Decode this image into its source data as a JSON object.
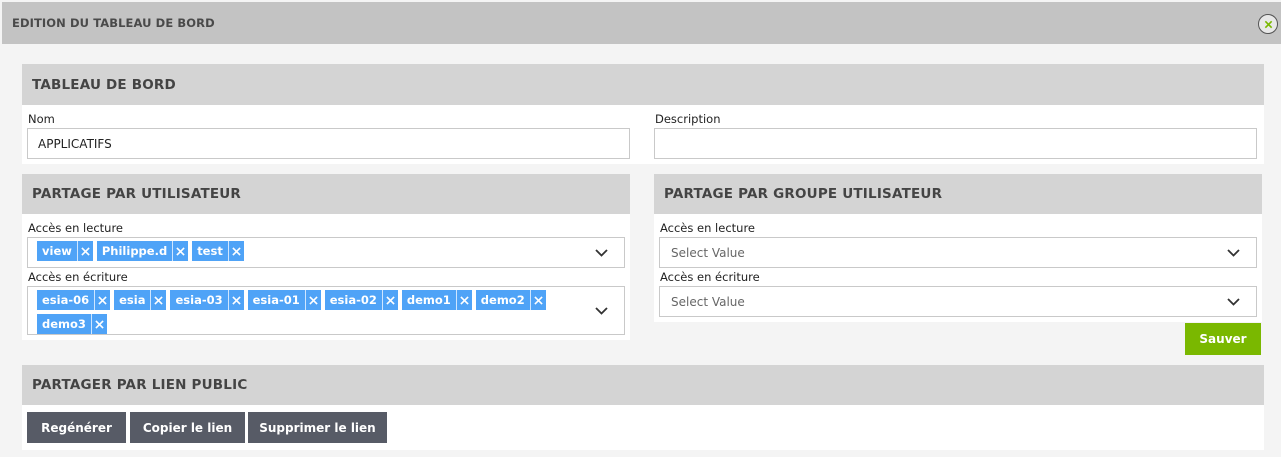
{
  "window": {
    "title": "EDITION DU TABLEAU DE BORD"
  },
  "dashboard": {
    "section_title": "TABLEAU DE BORD",
    "name_label": "Nom",
    "name_value": "APPLICATIFS",
    "description_label": "Description",
    "description_value": ""
  },
  "user_sharing": {
    "section_title": "PARTAGE PAR UTILISATEUR",
    "read_label": "Accès en lecture",
    "read_tags": [
      "view",
      "Philippe.d",
      "test"
    ],
    "write_label": "Accès en écriture",
    "write_tags": [
      "esia-06",
      "esia",
      "esia-03",
      "esia-01",
      "esia-02",
      "demo1",
      "demo2",
      "demo3"
    ]
  },
  "group_sharing": {
    "section_title": "PARTAGE PAR GROUPE UTILISATEUR",
    "read_label": "Accès en lecture",
    "read_placeholder": "Select Value",
    "write_label": "Accès en écriture",
    "write_placeholder": "Select Value"
  },
  "save_label": "Sauver",
  "public_link": {
    "section_title": "PARTAGER PAR LIEN PUBLIC",
    "regenerate_label": "Regénérer",
    "copy_label": "Copier le lien",
    "delete_label": "Supprimer le lien"
  },
  "colors": {
    "tag": "#4fa3f7",
    "save_button": "#7ab800",
    "action_button": "#575b66",
    "section_header": "#d4d4d4",
    "title_bar": "#c3c3c3"
  }
}
